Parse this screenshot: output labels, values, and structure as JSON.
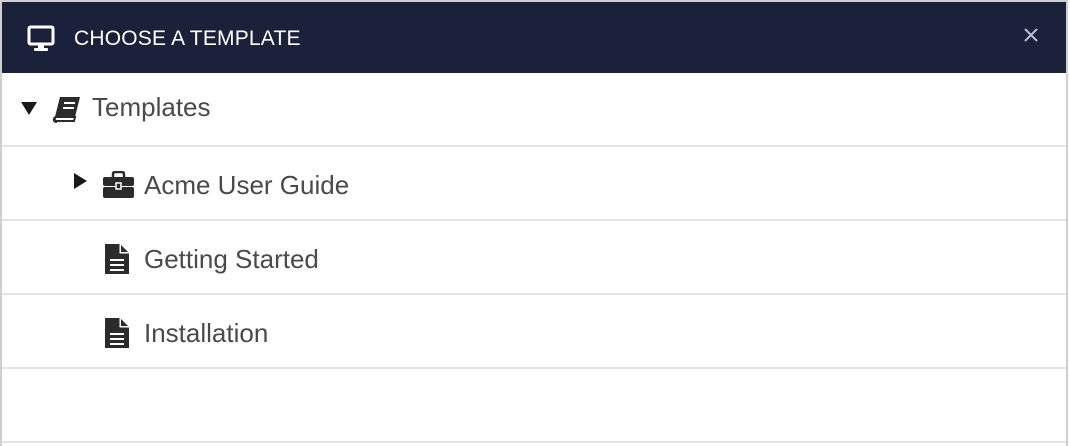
{
  "dialog": {
    "title": "CHOOSE A TEMPLATE",
    "header_icon": "monitor-icon",
    "close_icon": "close-icon",
    "header_bg": "#1b213a"
  },
  "tree": {
    "root": {
      "label": "Templates",
      "icon": "book-icon",
      "expanded": true
    },
    "children": [
      {
        "label": "Acme User Guide",
        "icon": "briefcase-icon",
        "expandable": true,
        "expanded": false
      },
      {
        "label": "Getting Started",
        "icon": "document-icon",
        "expandable": false
      },
      {
        "label": "Installation",
        "icon": "document-icon",
        "expandable": false
      }
    ]
  }
}
